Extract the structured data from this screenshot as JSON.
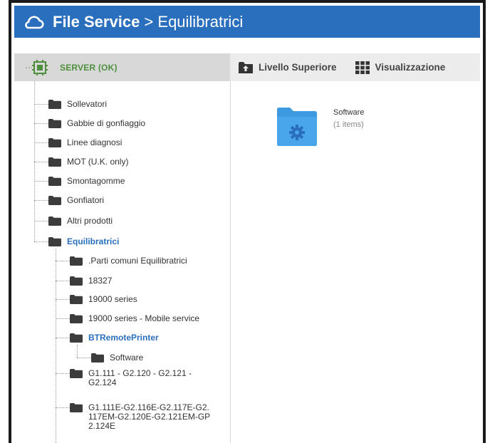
{
  "header": {
    "app_name": "File Service",
    "separator": " > ",
    "location": "Equilibratrici"
  },
  "toolbar": {
    "server_label": "SERVER (OK)",
    "up_label": "Livello Superiore",
    "view_label": "Visualizzazione"
  },
  "tree": {
    "root": [
      "Sollevatori",
      "Gabbie di gonfiaggio",
      "Linee diagnosi",
      "MOT (U.K. only)",
      "Smontagomme",
      "Gonfiatori",
      "Altri prodotti",
      "Equilibratrici"
    ],
    "equilibratrici_children": [
      ".Parti comuni Equilibratrici",
      "18327",
      "19000 series",
      "19000 series - Mobile service",
      "BTRemotePrinter",
      "G1.111 - G2.120 - G2.121 - G2.124",
      "G1.111E-G2.116E-G2.117E-G2.117EM-G2.120E-G2.121EM-GP2.124E"
    ],
    "btremote_children": [
      "Software"
    ]
  },
  "content": {
    "items": [
      {
        "name": "Software",
        "count": "(1 items)"
      }
    ]
  },
  "colors": {
    "header_bg": "#2a6fbe",
    "server_ok": "#4d8f3c",
    "folder": "#3c3c3c",
    "active_link": "#2a6fbe",
    "big_folder": "#3d9ae0"
  }
}
